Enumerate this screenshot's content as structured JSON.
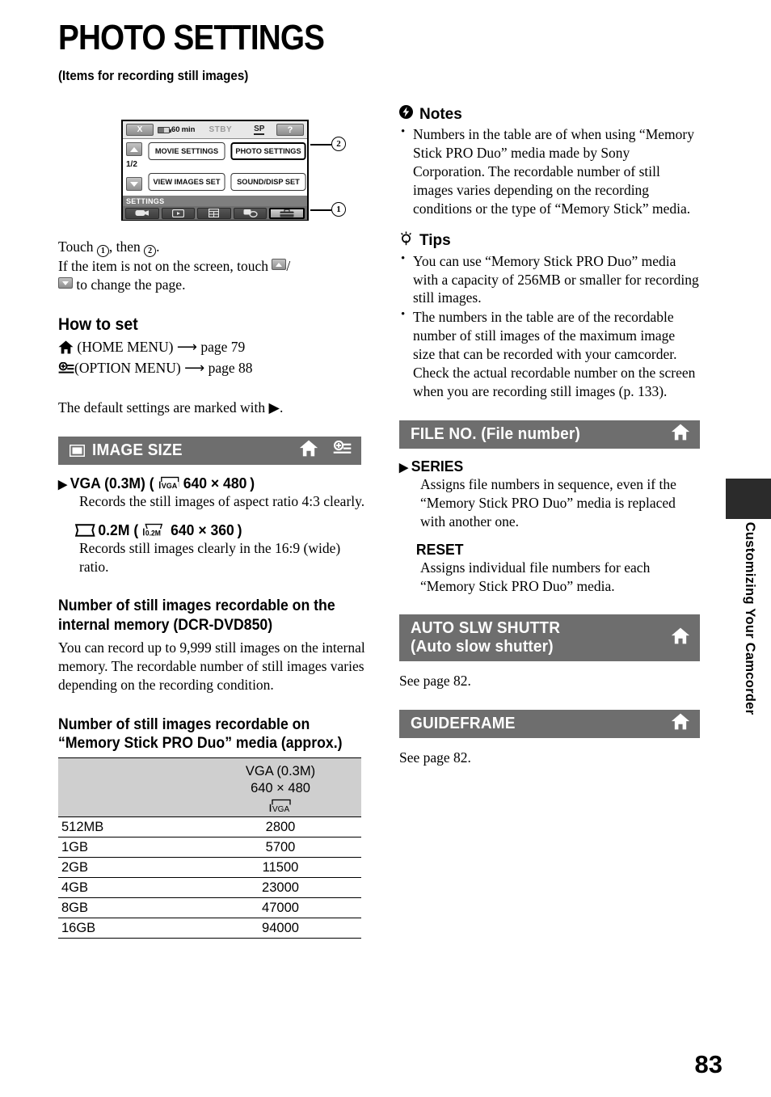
{
  "page": {
    "title": "PHOTO SETTINGS",
    "subtitle": "(Items for recording still images)",
    "page_number": "83",
    "edge_tab_label": "Customizing Your Camcorder"
  },
  "lcd": {
    "close_label": "X",
    "battery_time": "60",
    "battery_unit": "min",
    "status": "STBY",
    "rec_mode": "SP",
    "help_label": "?",
    "page_indicator": "1/2",
    "buttons": [
      "MOVIE SETTINGS",
      "PHOTO SETTINGS",
      "VIEW IMAGES SET",
      "SOUND/DISP SET"
    ],
    "category_label": "SETTINGS",
    "tabs": [
      "camera-tab",
      "playback-tab",
      "manage-media-tab",
      "others-tab",
      "settings-tab"
    ],
    "callout_1": "1",
    "callout_2": "2"
  },
  "instructions": {
    "line1_pre": "Touch",
    "line1_mid": ", then",
    "line1_end": ".",
    "line2_pre": "If the item is not on the screen, touch",
    "line2_sep": "/",
    "line3_end": "to change the page."
  },
  "how_to_set": {
    "heading": "How to set",
    "home_menu": "(HOME MENU)",
    "home_menu_page": "page 79",
    "option_menu": "(OPTION MENU)",
    "option_menu_page": "page 88",
    "default_note_pre": "The default settings are marked with",
    "default_note_end": "."
  },
  "image_size": {
    "bar_title": "IMAGE SIZE",
    "options": [
      {
        "name": "VGA (0.3M) (",
        "badge": "VGA",
        "dims": "640 × 480",
        "close": ")",
        "default": true,
        "desc": "Records the still images of aspect ratio 4:3 clearly."
      },
      {
        "name": "0.2M (",
        "badge": "0.2M",
        "dims": "640 × 360",
        "close": ")",
        "default": false,
        "desc": "Records still images clearly in the 16:9 (wide) ratio."
      }
    ]
  },
  "internal_memory": {
    "heading": "Number of still images recordable on the internal memory (DCR-DVD850)",
    "body": "You can record up to 9,999 still images on the internal memory. The recordable number of still images varies depending on the recording condition."
  },
  "ms_table": {
    "heading": "Number of still images recordable on “Memory Stick PRO Duo” media (approx.)",
    "column_header_line1": "VGA (0.3M)",
    "column_header_line2": "640 × 480",
    "column_header_badge": "VGA",
    "rows": [
      {
        "capacity": "512MB",
        "count": "2800"
      },
      {
        "capacity": "1GB",
        "count": "5700"
      },
      {
        "capacity": "2GB",
        "count": "11500"
      },
      {
        "capacity": "4GB",
        "count": "23000"
      },
      {
        "capacity": "8GB",
        "count": "47000"
      },
      {
        "capacity": "16GB",
        "count": "94000"
      }
    ]
  },
  "notes": {
    "heading": "Notes",
    "items": [
      "Numbers in the table are of when using “Memory Stick PRO Duo” media made by Sony Corporation. The recordable number of still images varies depending on the recording conditions or the type of “Memory Stick” media."
    ]
  },
  "tips": {
    "heading": "Tips",
    "items": [
      "You can use “Memory Stick PRO Duo” media with a capacity of 256MB or smaller for recording still images.",
      "The numbers in the table are of the recordable number of still images of the maximum image size that can be recorded with your camcorder. Check the actual recordable number on the screen when you are recording still images (p. 133)."
    ]
  },
  "file_no": {
    "bar_title": "FILE NO. (File number)",
    "options": [
      {
        "name": "SERIES",
        "default": true,
        "desc": "Assigns file numbers in sequence, even if the “Memory Stick PRO Duo” media is replaced with another one."
      },
      {
        "name": "RESET",
        "default": false,
        "desc": "Assigns individual file numbers for each “Memory Stick PRO Duo” media."
      }
    ]
  },
  "auto_slw_shuttr": {
    "bar_title_line1": "AUTO SLW SHUTTR",
    "bar_title_line2": "(Auto slow shutter)",
    "body": "See page 82."
  },
  "guideframe": {
    "bar_title": "GUIDEFRAME",
    "body": "See page 82."
  },
  "colors": {
    "section_bar": "#6e6e6e",
    "table_header": "#cfcfcf",
    "edge_tab": "#2b2b2b"
  }
}
